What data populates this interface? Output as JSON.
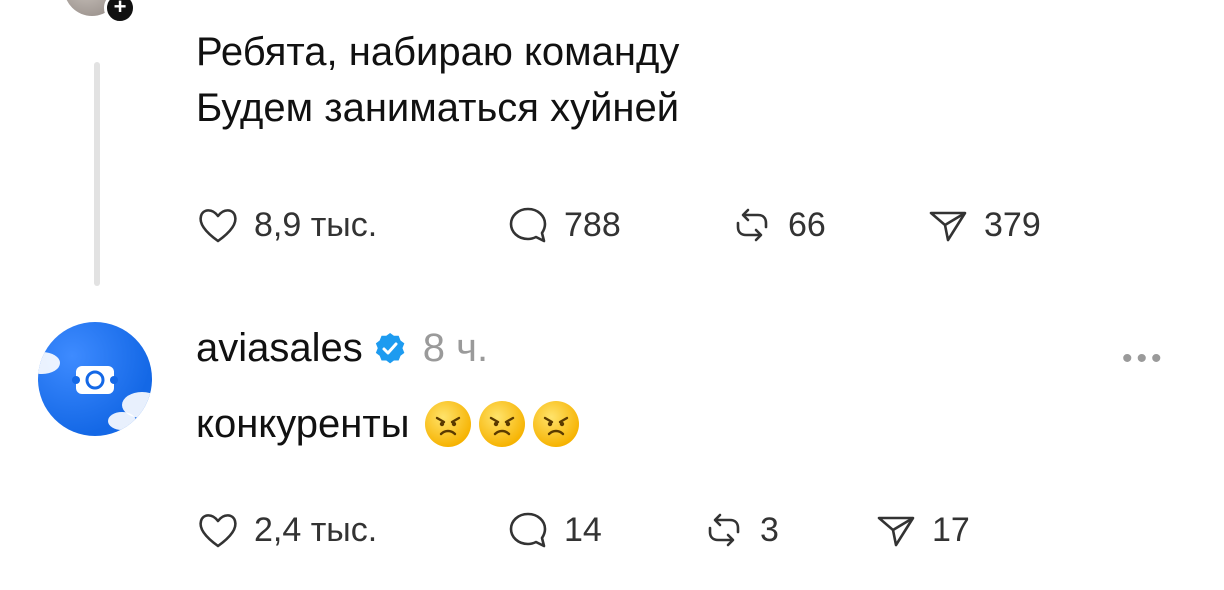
{
  "post1": {
    "lines": [
      "Ребята, набираю команду",
      "Будем заниматься хуйней"
    ],
    "likes": "8,9 тыс.",
    "replies": "788",
    "reposts": "66",
    "shares": "379"
  },
  "post2": {
    "username": "aviasales",
    "time": "8 ч.",
    "text": "конкуренты",
    "emoji": [
      "angry-face",
      "angry-face",
      "angry-face"
    ],
    "likes": "2,4 тыс.",
    "replies": "14",
    "reposts": "3",
    "shares": "17"
  },
  "colors": {
    "verified": "#1d9bf0",
    "avatar_bg": "#1a6ff0",
    "muted": "#9a9a9a"
  }
}
